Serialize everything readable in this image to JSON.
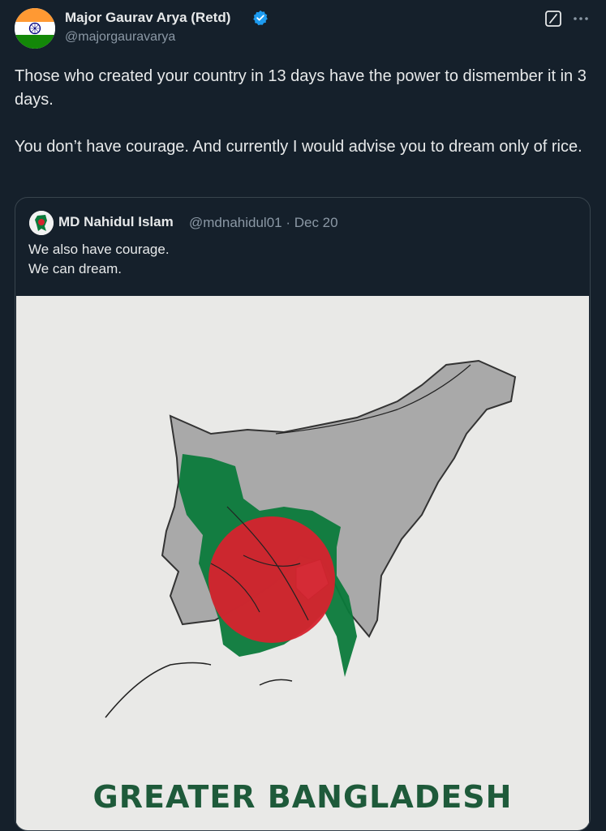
{
  "author": {
    "name": "Major Gaurav Arya (Retd)",
    "handle": "@majorgauravarya"
  },
  "icons": {
    "avatar": "india-flag-icon",
    "verified": "verified-badge-icon",
    "grok": "grok-icon",
    "more": "more-options-icon"
  },
  "tweet": {
    "paragraph1": "Those who created your country in 13 days have the power to dismember it in 3 days.",
    "paragraph2": "You don’t have courage. And currently I would advise you to dream only of rice."
  },
  "quoted": {
    "name": "MD Nahidul Islam",
    "handle_date": "@mdnahidul01 · Dec 20",
    "line1": "We also have courage.",
    "line2": "We can dream.",
    "image_caption": "GREATER BANGLADESH"
  },
  "colors": {
    "background": "#15202b",
    "text": "#e7e9ea",
    "secondary": "#8b98a5",
    "verified": "#1d9bf0",
    "map_green": "#0b7a3b",
    "map_red": "#d6232e"
  }
}
